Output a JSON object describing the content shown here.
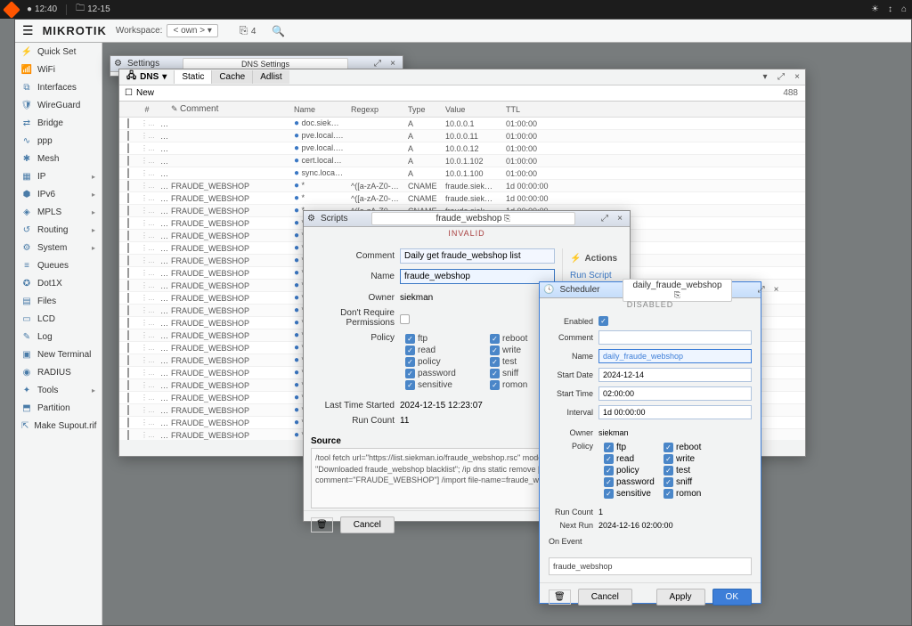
{
  "topbar": {
    "clock1": "12:40",
    "clock2": "12-15"
  },
  "brand": "MIKROTIK",
  "workspace": {
    "label": "Workspace:",
    "value": "< own >",
    "sessions": "4"
  },
  "sidebar": [
    {
      "label": "Quick Set",
      "icon": "⚡",
      "sub": false
    },
    {
      "label": "WiFi",
      "icon": "📶",
      "sub": false
    },
    {
      "label": "Interfaces",
      "icon": "⧉",
      "sub": false
    },
    {
      "label": "WireGuard",
      "icon": "🛡",
      "sub": false
    },
    {
      "label": "Bridge",
      "icon": "⇄",
      "sub": false
    },
    {
      "label": "ppp",
      "icon": "∿",
      "sub": false
    },
    {
      "label": "Mesh",
      "icon": "✱",
      "sub": false
    },
    {
      "label": "IP",
      "icon": "▦",
      "sub": true
    },
    {
      "label": "IPv6",
      "icon": "⬢",
      "sub": true
    },
    {
      "label": "MPLS",
      "icon": "◈",
      "sub": true
    },
    {
      "label": "Routing",
      "icon": "↺",
      "sub": true
    },
    {
      "label": "System",
      "icon": "⚙",
      "sub": true
    },
    {
      "label": "Queues",
      "icon": "≡",
      "sub": false
    },
    {
      "label": "Dot1X",
      "icon": "✪",
      "sub": false
    },
    {
      "label": "Files",
      "icon": "▤",
      "sub": false
    },
    {
      "label": "LCD",
      "icon": "▭",
      "sub": false
    },
    {
      "label": "Log",
      "icon": "✎",
      "sub": false
    },
    {
      "label": "New Terminal",
      "icon": "▣",
      "sub": false
    },
    {
      "label": "RADIUS",
      "icon": "◉",
      "sub": false
    },
    {
      "label": "Tools",
      "icon": "✦",
      "sub": true
    },
    {
      "label": "Partition",
      "icon": "⬒",
      "sub": false
    },
    {
      "label": "Make Supout.rif",
      "icon": "⇱",
      "sub": false
    }
  ],
  "settings": {
    "title": "Settings",
    "tab": "DNS Settings"
  },
  "dns": {
    "title": "DNS",
    "tabs": [
      "Static",
      "Cache",
      "Adlist"
    ],
    "new": "New",
    "count": "488",
    "headers": {
      "hash": "#",
      "comment": "Comment",
      "name": "Name",
      "regexp": "Regexp",
      "type": "Type",
      "value": "Value",
      "ttl": "TTL"
    },
    "rows": [
      {
        "comment": "",
        "name": "doc.siekman...",
        "regexp": "",
        "type": "A",
        "value": "10.0.0.1",
        "ttl": "01:00:00"
      },
      {
        "comment": "",
        "name": "pve.local.sie...",
        "regexp": "",
        "type": "A",
        "value": "10.0.0.11",
        "ttl": "01:00:00"
      },
      {
        "comment": "",
        "name": "pve.local.sie...",
        "regexp": "",
        "type": "A",
        "value": "10.0.0.12",
        "ttl": "01:00:00"
      },
      {
        "comment": "",
        "name": "cert.local.sie...",
        "regexp": "",
        "type": "A",
        "value": "10.0.1.102",
        "ttl": "01:00:00"
      },
      {
        "comment": "",
        "name": "sync.local.si...",
        "regexp": "",
        "type": "A",
        "value": "10.0.1.100",
        "ttl": "01:00:00"
      },
      {
        "comment": "FRAUDE_WEBSHOP",
        "name": "*",
        "regexp": "^([a-zA-Z0-9-]+...",
        "type": "CNAME",
        "value": "fraude.siekman.io",
        "ttl": "1d 00:00:00"
      },
      {
        "comment": "FRAUDE_WEBSHOP",
        "name": "*",
        "regexp": "^([a-zA-Z0-9-]+...",
        "type": "CNAME",
        "value": "fraude.siekman.io",
        "ttl": "1d 00:00:00"
      },
      {
        "comment": "FRAUDE_WEBSHOP",
        "name": "*",
        "regexp": "^([a-zA-Z0-9-]+...",
        "type": "CNAME",
        "value": "fraude.siekman.io",
        "ttl": "1d 00:00:00"
      },
      {
        "comment": "FRAUDE_WEBSHOP",
        "name": "*",
        "regexp": "",
        "type": "",
        "value": "",
        "ttl": ""
      },
      {
        "comment": "FRAUDE_WEBSHOP",
        "name": "*",
        "regexp": "",
        "type": "",
        "value": "",
        "ttl": ""
      },
      {
        "comment": "FRAUDE_WEBSHOP",
        "name": "*",
        "regexp": "",
        "type": "",
        "value": "",
        "ttl": ""
      },
      {
        "comment": "FRAUDE_WEBSHOP",
        "name": "*",
        "regexp": "",
        "type": "",
        "value": "",
        "ttl": ""
      },
      {
        "comment": "FRAUDE_WEBSHOP",
        "name": "*",
        "regexp": "",
        "type": "",
        "value": "",
        "ttl": ""
      },
      {
        "comment": "FRAUDE_WEBSHOP",
        "name": "*",
        "regexp": "",
        "type": "",
        "value": "",
        "ttl": ""
      },
      {
        "comment": "FRAUDE_WEBSHOP",
        "name": "*",
        "regexp": "",
        "type": "",
        "value": "",
        "ttl": ""
      },
      {
        "comment": "FRAUDE_WEBSHOP",
        "name": "*",
        "regexp": "",
        "type": "",
        "value": "",
        "ttl": ""
      },
      {
        "comment": "FRAUDE_WEBSHOP",
        "name": "*",
        "regexp": "",
        "type": "",
        "value": "",
        "ttl": ""
      },
      {
        "comment": "FRAUDE_WEBSHOP",
        "name": "*",
        "regexp": "",
        "type": "",
        "value": "",
        "ttl": ""
      },
      {
        "comment": "FRAUDE_WEBSHOP",
        "name": "*",
        "regexp": "",
        "type": "",
        "value": "",
        "ttl": ""
      },
      {
        "comment": "FRAUDE_WEBSHOP",
        "name": "*",
        "regexp": "",
        "type": "",
        "value": "",
        "ttl": ""
      },
      {
        "comment": "FRAUDE_WEBSHOP",
        "name": "*",
        "regexp": "",
        "type": "",
        "value": "",
        "ttl": ""
      },
      {
        "comment": "FRAUDE_WEBSHOP",
        "name": "*",
        "regexp": "",
        "type": "",
        "value": "",
        "ttl": ""
      },
      {
        "comment": "FRAUDE_WEBSHOP",
        "name": "*",
        "regexp": "",
        "type": "",
        "value": "",
        "ttl": ""
      },
      {
        "comment": "FRAUDE_WEBSHOP",
        "name": "*",
        "regexp": "",
        "type": "",
        "value": "",
        "ttl": ""
      },
      {
        "comment": "FRAUDE_WEBSHOP",
        "name": "*",
        "regexp": "",
        "type": "",
        "value": "",
        "ttl": ""
      },
      {
        "comment": "FRAUDE_WEBSHOP",
        "name": "*",
        "regexp": "",
        "type": "",
        "value": "",
        "ttl": ""
      },
      {
        "comment": "FRAUDE_WEBSHOP",
        "name": "*",
        "regexp": "",
        "type": "",
        "value": "",
        "ttl": ""
      }
    ]
  },
  "scripts": {
    "title": "Scripts",
    "tab": "fraude_webshop",
    "banner": "INVALID",
    "labels": {
      "comment": "Comment",
      "name": "Name",
      "owner": "Owner",
      "dont_req": "Don't Require Permissions",
      "policy": "Policy",
      "last_time": "Last Time Started",
      "run_count": "Run Count",
      "source": "Source"
    },
    "comment": "Daily get fraude_webshop list",
    "name": "fraude_webshop",
    "owner": "siekman",
    "last_time": "2024-12-15 12:23:07",
    "run_count": "11",
    "policies": [
      "ftp",
      "reboot",
      "read",
      "write",
      "policy",
      "test",
      "password",
      "sniff",
      "sensitive",
      "romon"
    ],
    "source": "/tool fetch url=\"https://list.siekman.io/fraude_webshop.rsc\" mode=https;\n:log info \"Downloaded fraude_webshop blacklist\";\n/ip dns static remove [find where comment=\"FRAUDE_WEBSHOP\"]\n/import file-name=fraude_webshop.rsc;",
    "cancel": "Cancel",
    "actions": "Actions",
    "run_script": "Run Script"
  },
  "sched": {
    "title": "Scheduler",
    "tab": "daily_fraude_webshop",
    "banner": "DISABLED",
    "labels": {
      "enabled": "Enabled",
      "comment": "Comment",
      "name": "Name",
      "start_date": "Start Date",
      "start_time": "Start Time",
      "interval": "Interval",
      "owner": "Owner",
      "policy": "Policy",
      "run_count": "Run Count",
      "next_run": "Next Run",
      "on_event": "On Event"
    },
    "comment": "",
    "name": "daily_fraude_webshop",
    "start_date": "2024-12-14",
    "start_time": "02:00:00",
    "interval": "1d 00:00:00",
    "owner": "siekman",
    "policies": [
      "ftp",
      "reboot",
      "read",
      "write",
      "policy",
      "test",
      "password",
      "sniff",
      "sensitive",
      "romon"
    ],
    "run_count": "1",
    "next_run": "2024-12-16 02:00:00",
    "on_event": "fraude_webshop",
    "cancel": "Cancel",
    "apply": "Apply",
    "ok": "OK"
  }
}
